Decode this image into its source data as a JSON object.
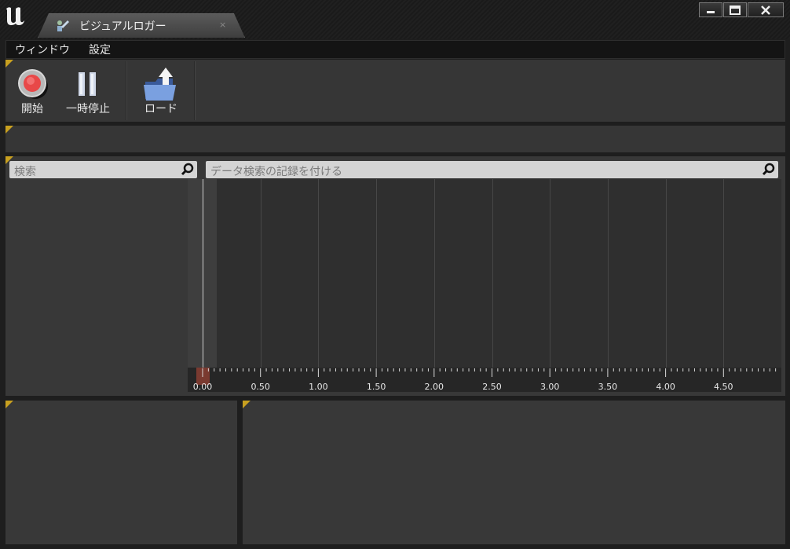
{
  "window": {
    "tab_title": "ビジュアルロガー",
    "tab_close": "×",
    "minimize_glyph": "▁",
    "maximize_glyph": "▭",
    "close_glyph": "✕"
  },
  "menu": {
    "items": [
      {
        "label": "ウィンドウ"
      },
      {
        "label": "設定"
      }
    ]
  },
  "toolbar": {
    "start_label": "開始",
    "pause_label": "一時停止",
    "load_label": "ロード"
  },
  "filters": {
    "search_placeholder": "検索",
    "log_search_placeholder": "データ検索の記録を付ける"
  },
  "timeline": {
    "ticks": [
      "0.00",
      "0.50",
      "1.00",
      "1.50",
      "2.00",
      "2.50",
      "3.00",
      "3.50",
      "4.00",
      "4.50"
    ]
  },
  "colors": {
    "accent_corner": "#c8a020",
    "record_red": "#e84848",
    "cursor_marker": "#7a3a30"
  }
}
